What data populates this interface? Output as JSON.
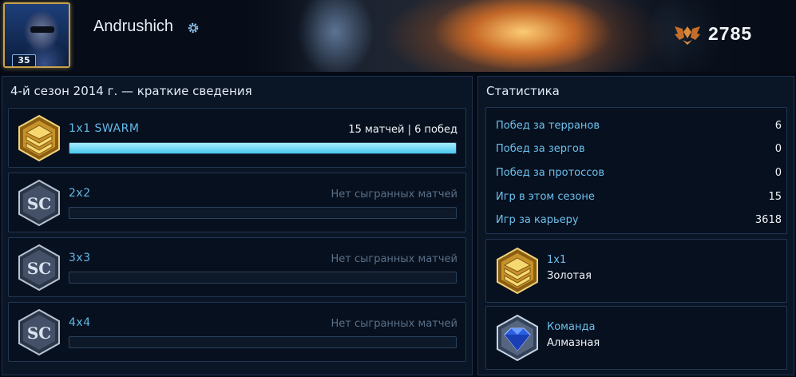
{
  "profile": {
    "name": "Andrushich",
    "level": "35",
    "points": "2785",
    "icons": {
      "settings": "gear-icon",
      "points": "achievement-wings-icon"
    }
  },
  "season": {
    "title": "4-й сезон 2014 г. — краткие сведения",
    "queues": [
      {
        "title": "1x1 SWARM",
        "status": "15 матчей | 6 побед",
        "progress": 1.0,
        "active": true,
        "emblem": "gold-league-icon"
      },
      {
        "title": "2x2",
        "status": "Нет сыгранных матчей",
        "progress": 0,
        "active": false,
        "emblem": "unranked-sc2-icon"
      },
      {
        "title": "3x3",
        "status": "Нет сыгранных матчей",
        "progress": 0,
        "active": false,
        "emblem": "unranked-sc2-icon"
      },
      {
        "title": "4x4",
        "status": "Нет сыгранных матчей",
        "progress": 0,
        "active": false,
        "emblem": "unranked-sc2-icon"
      }
    ]
  },
  "stats": {
    "title": "Статистика",
    "rows": [
      {
        "label": "Побед за терранов",
        "value": "6"
      },
      {
        "label": "Побед за зергов",
        "value": "0"
      },
      {
        "label": "Побед за протоссов",
        "value": "0"
      },
      {
        "label": "Игр в этом сезоне",
        "value": "15"
      },
      {
        "label": "Игр за карьеру",
        "value": "3618"
      }
    ],
    "leagues": [
      {
        "title": "1x1",
        "league": "Золотая",
        "emblem": "gold-league-icon"
      },
      {
        "title": "Команда",
        "league": "Алмазная",
        "emblem": "diamond-league-icon"
      }
    ]
  },
  "colors": {
    "accent": "#62b8e8",
    "progress": "#48c8ee",
    "gold": "#e2b13c",
    "diamond": "#2a5fe0"
  }
}
